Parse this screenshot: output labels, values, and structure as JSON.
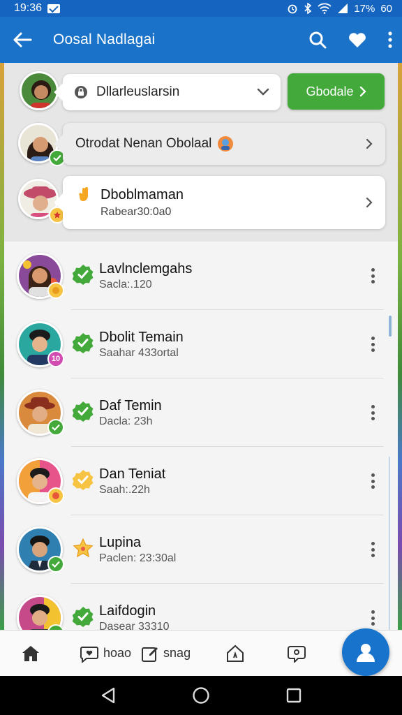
{
  "status_bar": {
    "time": "19:36",
    "battery": "17%",
    "extra": "60"
  },
  "app_bar": {
    "title": "Oosal Nadlagai"
  },
  "top_panel": {
    "search": {
      "value": "Dllarleuslarsin"
    },
    "cta": {
      "label": "Gbodale"
    },
    "chat": {
      "label": "Otrodat Nenan Obolaal"
    },
    "invite": {
      "title": "Dboblmaman",
      "subtitle": "Rabear30:0a0"
    }
  },
  "contacts": [
    {
      "name": "Lavlnclemgahs",
      "sub": "Sacla:.120",
      "badge": "",
      "status": "verified",
      "badge_color": "#f6c343"
    },
    {
      "name": "Dbolit Temain",
      "sub": "Saahar 433ortal",
      "badge": "10",
      "status": "verified",
      "badge_color": "#d24bb0"
    },
    {
      "name": "Daf Temin",
      "sub": "Dacla: 23h",
      "badge": "",
      "status": "verified",
      "badge_color": "#43a93a"
    },
    {
      "name": "Dan Teniat",
      "sub": "Saah:.22h",
      "badge": "",
      "status": "pending",
      "badge_color": "#f6c343"
    },
    {
      "name": "Lupina",
      "sub": "Paclen: 23:30al",
      "badge": "",
      "status": "star",
      "badge_color": "#43a93a"
    },
    {
      "name": "Laifdogin",
      "sub": "Dasear 33310",
      "badge": "",
      "status": "verified",
      "badge_color": "#43a93a"
    }
  ],
  "bottom_nav": {
    "item2_label": "hoao",
    "item3_label": "snag"
  },
  "colors": {
    "primary": "#1a73c8",
    "green": "#43a93a",
    "yellow": "#f6c343"
  }
}
